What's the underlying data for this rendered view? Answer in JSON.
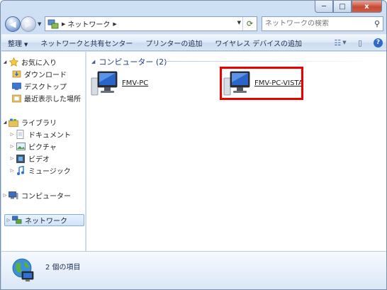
{
  "window": {
    "minimize": "─",
    "maximize": "□",
    "close": "x"
  },
  "address": {
    "path_segment": "ネットワーク",
    "search_placeholder": "ネットワークの検索"
  },
  "toolbar": {
    "organize": "整理",
    "network_center": "ネットワークと共有センター",
    "add_printer": "プリンターの追加",
    "add_wireless": "ワイヤレス デバイスの追加"
  },
  "nav": {
    "favorites": "お気に入り",
    "downloads": "ダウンロード",
    "desktop": "デスクトップ",
    "recent": "最近表示した場所",
    "libraries": "ライブラリ",
    "documents": "ドキュメント",
    "pictures": "ピクチャ",
    "videos": "ビデオ",
    "music": "ミュージック",
    "computer": "コンピューター",
    "network": "ネットワーク"
  },
  "content": {
    "group_header": "コンピューター (2)",
    "items": [
      {
        "label": "FMV-PC"
      },
      {
        "label": "FMV-PC-VISTA"
      }
    ]
  },
  "status": {
    "item_count": "2 個の項目"
  },
  "colors": {
    "highlight": "#ee0000",
    "group_header": "#1e3f8c",
    "selection": "#cfe3fb"
  }
}
